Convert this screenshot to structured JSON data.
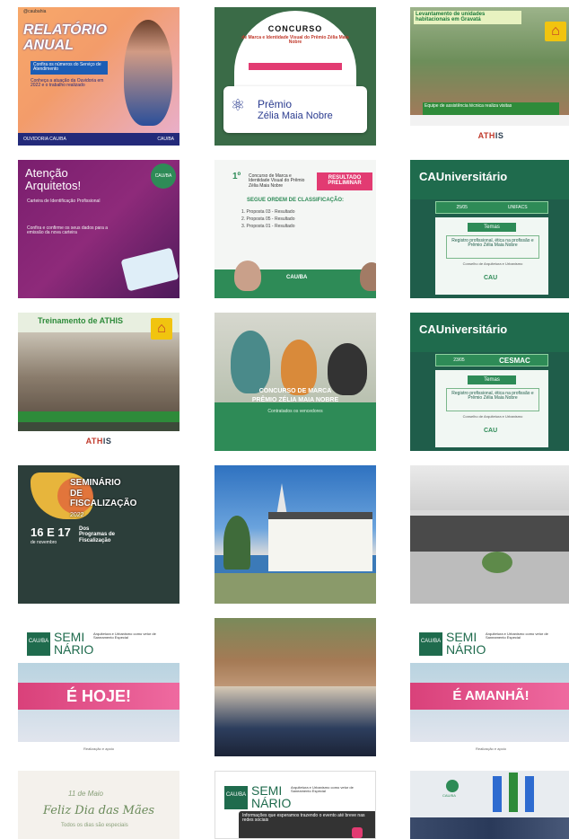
{
  "tiles": {
    "t1": {
      "handle": "@caubahia",
      "title1": "RELATÓRIO",
      "title2": "ANUAL",
      "box": "Confira os números do Serviço de Atendimento",
      "body": "Conheça a atuação da Ouvidoria em 2022 e o trabalho realizado",
      "footer_left": "OUVIDORIA CAU/BA",
      "footer_right": "CAU/BA",
      "icon": "person-photo"
    },
    "t2": {
      "heading": "CONCURSO",
      "sub": "de Marca e Identidade Visual do Prêmio Zélia Maia Nobre",
      "brand1": "Prêmio",
      "brand2": "Zélia Maia Nobre",
      "icon": "molecule-logo-icon"
    },
    "t3": {
      "header": "Levantamento de unidades habitacionais em Gravatá",
      "caption": "Equipe de assistência técnica realiza visitas",
      "logo_a": "ATH",
      "logo_b": "IS"
    },
    "t4": {
      "title1": "Atenção",
      "title2": "Arquitetos!",
      "line1": "Carteira de Identificação Profissional",
      "line2": "Confira e confirme os seus dados para a emissão da nova carteira",
      "badge": "CAU/BA"
    },
    "t5": {
      "number": "1º",
      "heading": "Concurso de Marca e Identidade Visual do Prêmio Zélia Maia Nobre",
      "tag": "RESULTADO PRELIMINAR",
      "order": "SEGUE ORDEM DE CLASSIFICAÇÃO:",
      "items": [
        "1. Proposta 03 - Resultado",
        "2. Proposta 05 - Resultado",
        "3. Proposta 01 - Resultado"
      ],
      "mark": "CAU/BA"
    },
    "t6": {
      "title": "CAUniversitário",
      "date": "25/05",
      "place": "UNIFACS",
      "temas": "Temas",
      "box": "Registro profissional, ética na profissão e Prêmio Zélia Maia Nobre",
      "small": "Conselho de Arquitetura e Urbanismo",
      "mark": "CAU"
    },
    "t7": {
      "banner": "Treinamento de ATHIS",
      "logo_a": "ATH",
      "logo_b": "IS"
    },
    "t8": {
      "line1": "CONCURSO DE MARCA",
      "line2": "PRÊMIO ZÉLIA MAIA NOBRE",
      "line3": "Contratados os vencedores"
    },
    "t10": {
      "title1": "SEMINÁRIO",
      "title2": "DE",
      "title3": "FISCALIZAÇÃO",
      "year": "2022",
      "date": "16 E 17",
      "month": "de novembro",
      "place1": "Dos",
      "place2": "Programas de",
      "place3": "Fiscalização"
    },
    "t12": {
      "title": "CAUniversitário",
      "date": "23/05",
      "place": "CESMAC",
      "temas": "Temas",
      "box": "Registro profissional, ética na profissão e Prêmio Zélia Maia Nobre",
      "small": "Conselho de Arquitetura e Urbanismo",
      "mark": "CAU"
    },
    "t14": {
      "logo": "CAU/BA",
      "semi1": "SEMI",
      "semi2": "NÁRIO",
      "desc": "Arquitetura e Urbanismo como vetor de Saneamento Especial",
      "banner": "É HOJE!",
      "partners": "Realização e apoio"
    },
    "t16": {
      "logo": "CAU/BA",
      "semi1": "SEMI",
      "semi2": "NÁRIO",
      "desc": "Arquitetura e Urbanismo como vetor de Saneamento Especial",
      "banner": "É AMANHÃ!",
      "partners": "Realização e apoio"
    },
    "t17": {
      "line1": "11 de Maio",
      "line2": "Feliz Dia das Mães",
      "line3": "Todos os dias são especiais"
    },
    "t18": {
      "logo": "CAU/BA",
      "semi1": "SEMI",
      "semi2": "NÁRIO",
      "desc": "Arquitetura e Urbanismo como vetor de Saneamento Especial",
      "dark": "Informações que esperamos trazendo o evento até breve nas redes sociais"
    },
    "t19": {
      "logo": "CAU/BA"
    }
  }
}
